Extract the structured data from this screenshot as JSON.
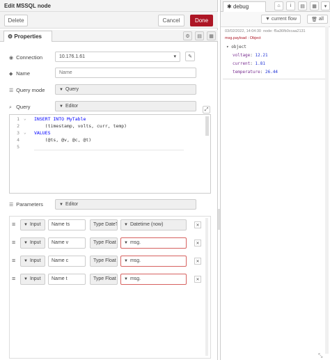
{
  "editor": {
    "title": "Edit MSSQL node",
    "delete_label": "Delete",
    "cancel_label": "Cancel",
    "done_label": "Done",
    "tab_properties": "Properties",
    "connection_label": "Connection",
    "connection_value": "10.176.1.61",
    "name_label": "Name",
    "name_placeholder": "Name",
    "query_mode_label": "Query mode",
    "query_mode_value": "Query",
    "query_label": "Query",
    "query_source_value": "Editor",
    "code_lines": [
      {
        "num": "1",
        "text": "INSERT INTO MyTable"
      },
      {
        "num": "2",
        "text": "    (timestamp, volts, curr, temp)"
      },
      {
        "num": "3",
        "text": "VALUES"
      },
      {
        "num": "4",
        "text": "    (@ts, @v, @c, @t)"
      },
      {
        "num": "5",
        "text": ""
      }
    ],
    "params_label": "Parameters",
    "params_source_value": "Editor",
    "params": [
      {
        "dir": "Input",
        "name_label": "Name",
        "name": "ts",
        "type_label": "Type",
        "type": "DateT",
        "value": "Datetime (now)",
        "value_kind": "grey"
      },
      {
        "dir": "Input",
        "name_label": "Name",
        "name": "v",
        "type_label": "Type",
        "type": "Float",
        "value": "msg.",
        "value_kind": "err"
      },
      {
        "dir": "Input",
        "name_label": "Name",
        "name": "c",
        "type_label": "Type",
        "type": "Float",
        "value": "msg.",
        "value_kind": "err"
      },
      {
        "dir": "Input",
        "name_label": "Name",
        "name": "t",
        "type_label": "Type",
        "type": "Float",
        "value": "msg.",
        "value_kind": "err"
      }
    ]
  },
  "sidebar": {
    "tab_label": "debug",
    "filter_label": "current flow",
    "all_label": "all",
    "message": {
      "timestamp": "03/02/2022, 14:04:30",
      "node": "node: f5a36fb0ccaa2131",
      "topic": "msg.payload : Object",
      "object_label": "object",
      "fields": [
        {
          "key": "voltage",
          "value": "12.21"
        },
        {
          "key": "current",
          "value": "1.81"
        },
        {
          "key": "temperature",
          "value": "26.44"
        }
      ]
    }
  }
}
